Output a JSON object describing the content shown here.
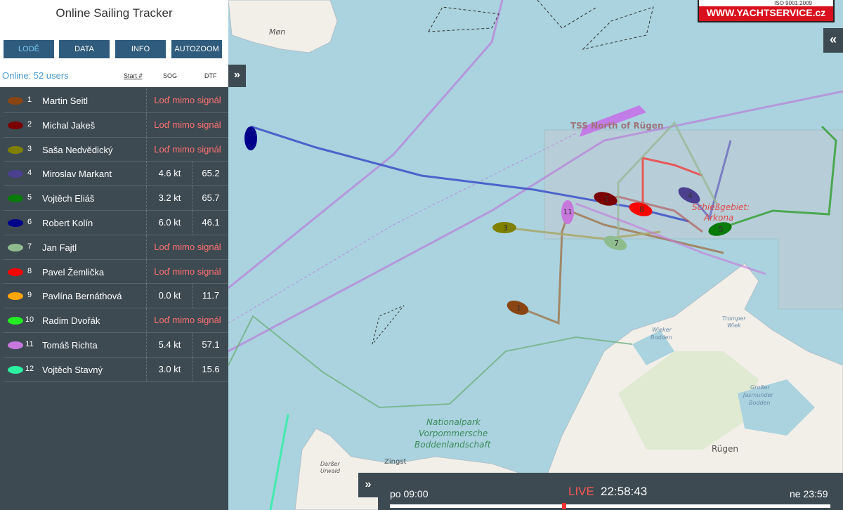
{
  "app": {
    "title": "Online Sailing Tracker"
  },
  "nav": {
    "lode": "LODĚ",
    "data": "DATA",
    "info": "INFO",
    "autozoom": "AUTOZOOM"
  },
  "list_header": {
    "online": "Online: 52 users",
    "start": "Start #",
    "sog": "SOG",
    "dtf": "DTF"
  },
  "boats": [
    {
      "num": "1",
      "name": "Martin Seitl",
      "color": "#8b4513",
      "signal": "Loď mimo signál"
    },
    {
      "num": "2",
      "name": "Michal Jakeš",
      "color": "#7a0000",
      "signal": "Loď mimo signál"
    },
    {
      "num": "3",
      "name": "Saša Nedvědický",
      "color": "#808000",
      "signal": "Loď mimo signál"
    },
    {
      "num": "4",
      "name": "Miroslav Markant",
      "color": "#4b3f8f",
      "sog": "4.6 kt",
      "dtf": "65.2"
    },
    {
      "num": "5",
      "name": "Vojtěch Eliáš",
      "color": "#0a7a0a",
      "sog": "3.2 kt",
      "dtf": "65.7"
    },
    {
      "num": "6",
      "name": "Robert Kolín",
      "color": "#00008b",
      "sog": "6.0 kt",
      "dtf": "46.1"
    },
    {
      "num": "7",
      "name": "Jan Fajtl",
      "color": "#8fbc8f",
      "signal": "Loď mimo signál"
    },
    {
      "num": "8",
      "name": "Pavel Žemlička",
      "color": "#ff0000",
      "signal": "Loď mimo signál"
    },
    {
      "num": "9",
      "name": "Pavlína Bernáthová",
      "color": "#ffa500",
      "sog": "0.0 kt",
      "dtf": "11.7"
    },
    {
      "num": "10",
      "name": "Radim Dvořák",
      "color": "#22ee22",
      "signal": "Loď mimo signál"
    },
    {
      "num": "11",
      "name": "Tomáš Richta",
      "color": "#c678dd",
      "sog": "5.4 kt",
      "dtf": "57.1"
    },
    {
      "num": "12",
      "name": "Vojtěch Stavný",
      "color": "#2af0a0",
      "sog": "3.0 kt",
      "dtf": "15.6"
    }
  ],
  "map_labels": {
    "mon": "Møn",
    "tss": "TSS North of Rügen",
    "schiess1": "Schießgebiet:",
    "schiess2": "Arkona",
    "np1": "Nationalpark",
    "np2": "Vorpommersche",
    "np3": "Boddenlandschaft",
    "zingst": "Zingst",
    "rugen": "Rügen",
    "darsser": "Darßer",
    "urwald": "Urwald",
    "wieker": "Wieker",
    "bodden": "Bodden",
    "tromper": "Tromper",
    "wiek": "Wiek",
    "grosser": "Großer",
    "jasmunder": "Jasmunder",
    "bodden2": "Bodden"
  },
  "logo": {
    "cert": "ISO 9001:2009",
    "brand": "WWW.YACHTSERVICE.cz"
  },
  "timeline": {
    "start": "po 09:00",
    "live": "LIVE",
    "time": "22:58:43",
    "end": "ne 23:59",
    "progress": 0.39
  },
  "controls": {
    "collapse_left": "»",
    "collapse_right": "«",
    "timeline_toggle": "»"
  }
}
